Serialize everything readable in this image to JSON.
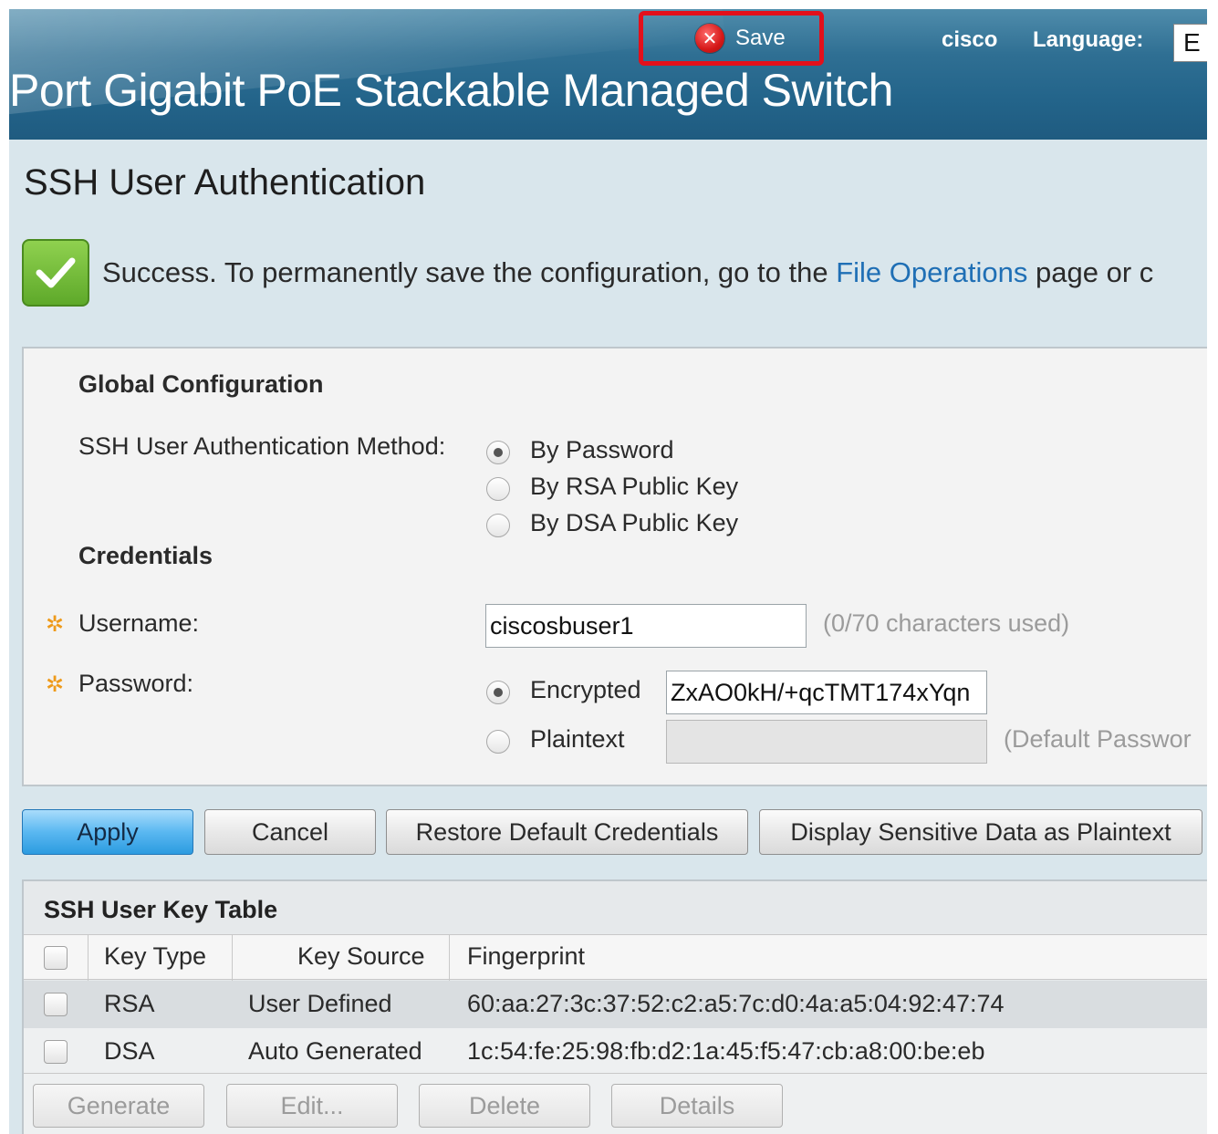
{
  "header": {
    "title": "Port Gigabit PoE Stackable Managed Switch",
    "save_label": "Save",
    "user": "cisco",
    "language_label": "Language:",
    "language_value": "E"
  },
  "page": {
    "title": "SSH User Authentication"
  },
  "success": {
    "text_before": "Success. To permanently save the configuration, go to the ",
    "link": "File Operations",
    "text_after": " page or c"
  },
  "global_config": {
    "heading": "Global Configuration",
    "method_label": "SSH User Authentication Method:",
    "methods": [
      {
        "label": "By Password",
        "checked": true
      },
      {
        "label": "By RSA Public Key",
        "checked": false
      },
      {
        "label": "By DSA Public Key",
        "checked": false
      }
    ],
    "credentials_heading": "Credentials",
    "username_label": "Username:",
    "username_value": "ciscosbuser1",
    "username_hint": "(0/70 characters used)",
    "password_label": "Password:",
    "encrypted_label": "Encrypted",
    "encrypted_value": "ZxAO0kH/+qcTMT174xYqn",
    "plaintext_label": "Plaintext",
    "plaintext_value": "",
    "plaintext_hint": "(Default Passwor"
  },
  "actions": {
    "apply": "Apply",
    "cancel": "Cancel",
    "restore": "Restore Default Credentials",
    "display": "Display Sensitive Data as Plaintext"
  },
  "key_table": {
    "title": "SSH User Key Table",
    "columns": [
      "Key Type",
      "Key Source",
      "Fingerprint"
    ],
    "rows": [
      {
        "key_type": "RSA",
        "key_source": "User Defined",
        "fingerprint": "60:aa:27:3c:37:52:c2:a5:7c:d0:4a:a5:04:92:47:74"
      },
      {
        "key_type": "DSA",
        "key_source": "Auto Generated",
        "fingerprint": "1c:54:fe:25:98:fb:d2:1a:45:f5:47:cb:a8:00:be:eb"
      }
    ],
    "buttons": {
      "generate": "Generate",
      "edit": "Edit...",
      "delete": "Delete",
      "details": "Details"
    }
  },
  "colors": {
    "header_blue": "#23648a",
    "save_highlight": "#e3101b",
    "success_green": "#5ea92a",
    "link_blue": "#1f6fb5",
    "required_orange": "#ee9a1a",
    "apply_blue": "#2c9be0"
  },
  "icons": {
    "save": "close-circle-icon",
    "success": "checkmark-icon",
    "required": "asterisk-gear-icon"
  }
}
